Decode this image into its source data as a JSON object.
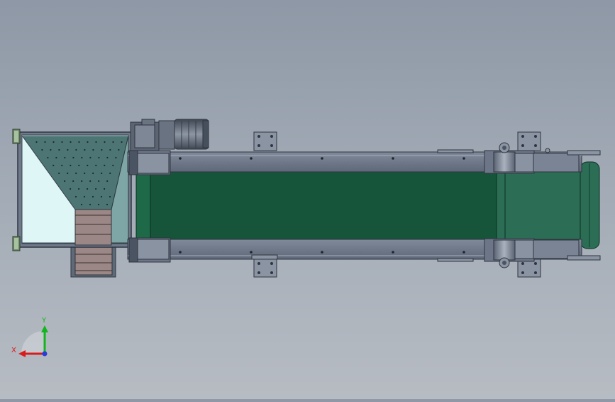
{
  "scene": {
    "model": "belt-conveyor-with-hopper",
    "view": "top"
  },
  "triad": {
    "x_label": "X",
    "y_label": "Y",
    "x_color": "#d81b1b",
    "y_color": "#12b51c",
    "z_color": "#2a3cd8"
  },
  "colors": {
    "belt": "#16553a",
    "belt_edge": "#0f3f2a",
    "belt_end": "#2b6e55",
    "frame": "#6b7586",
    "frame_dark": "#434b58",
    "frame_light": "#9aa3b2",
    "hopper_inner": "#dff6f7",
    "hopper_wall": "#4d7574",
    "hopper_side": "#7fa6a6",
    "chute": "#9b8785",
    "motor": "#56606d"
  }
}
